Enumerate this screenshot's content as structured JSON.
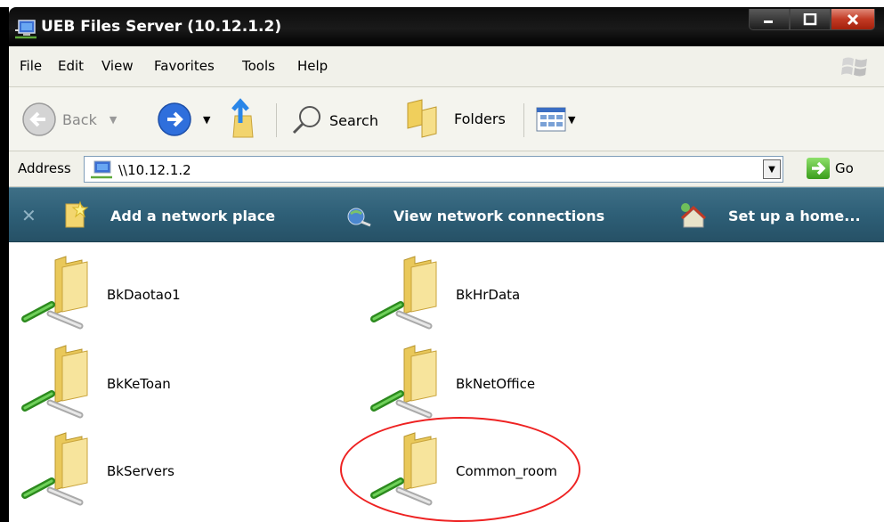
{
  "window": {
    "title": "UEB Files Server (10.12.1.2)",
    "buttons": [
      "minimize",
      "maximize",
      "close"
    ]
  },
  "menu": [
    "File",
    "Edit",
    "View",
    "Favorites",
    "Tools",
    "Help"
  ],
  "toolbar": {
    "back": "Back",
    "search": "Search",
    "folders": "Folders"
  },
  "address": {
    "label": "Address",
    "value": "\\\\10.12.1.2",
    "go": "Go"
  },
  "tasks": [
    {
      "label": "Add a network place",
      "icon": "add-network-place-icon"
    },
    {
      "label": "View network connections",
      "icon": "network-connections-icon"
    },
    {
      "label": "Set up a home...",
      "icon": "home-network-icon"
    }
  ],
  "shares": [
    {
      "name": "BkDaotao1"
    },
    {
      "name": "BkHrData"
    },
    {
      "name": "BkKeToan"
    },
    {
      "name": "BkNetOffice"
    },
    {
      "name": "BkServers"
    },
    {
      "name": "Common_room"
    }
  ],
  "colors": {
    "taskbar": "#2e5f77",
    "highlight": "#e22222",
    "folder": "#f3dc85"
  }
}
